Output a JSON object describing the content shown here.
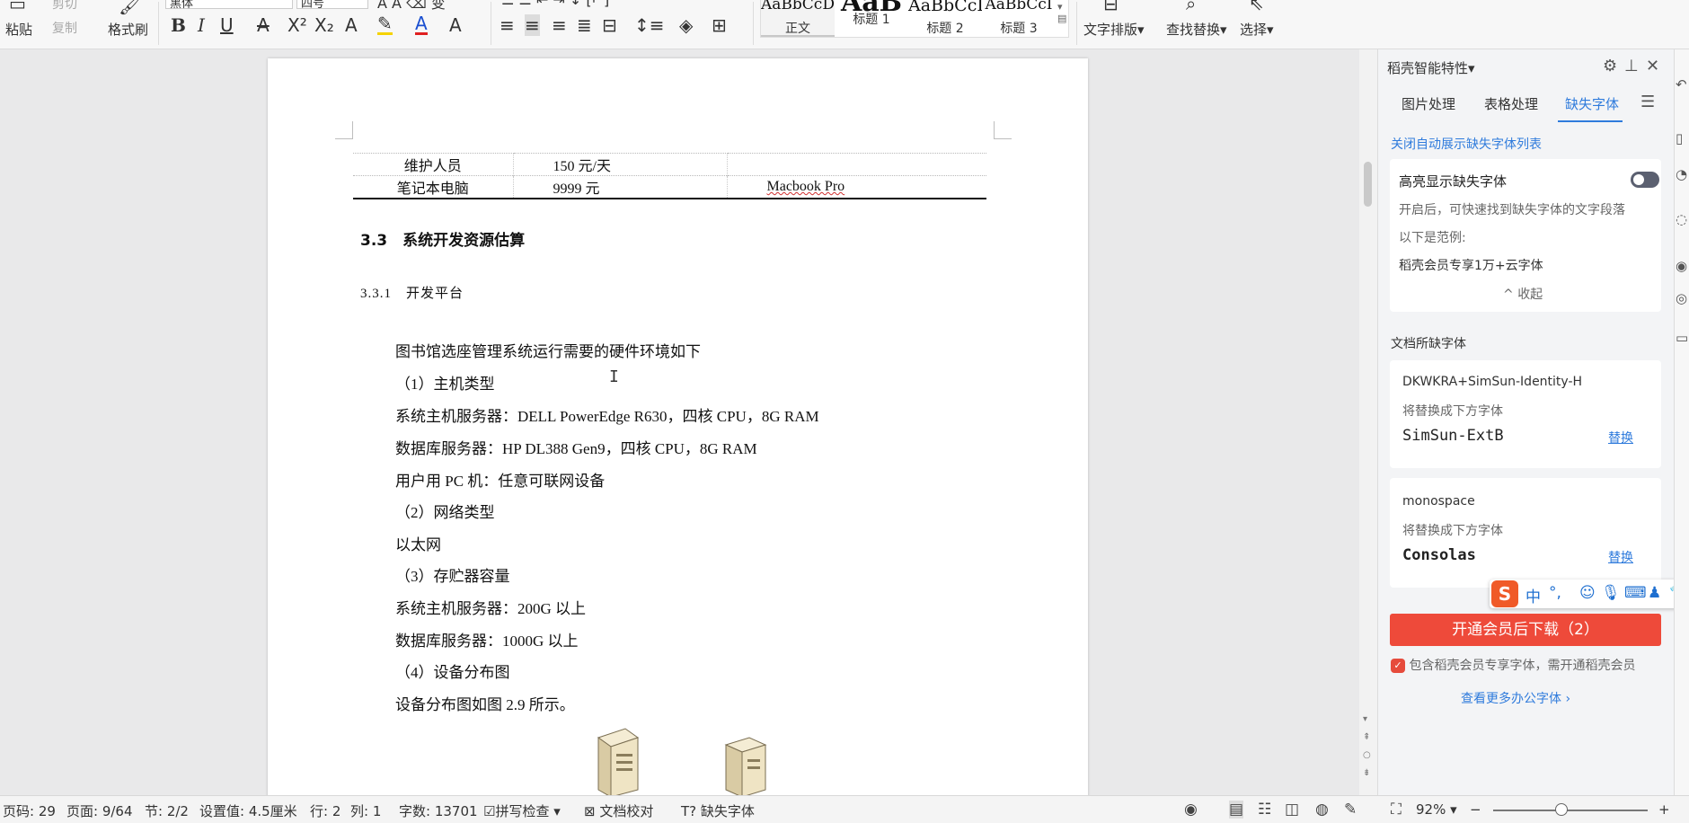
{
  "ribbon": {
    "paste": "粘贴",
    "cut": "剪切",
    "copy": "复制",
    "format_painter": "格式刷",
    "font_name": "黑体",
    "font_size": "四号",
    "styles": [
      {
        "sample": "AaBbCcDc",
        "label": "正文"
      },
      {
        "sample": "AaB",
        "label": "标题 1"
      },
      {
        "sample": "AaBbCcI",
        "label": "标题 2"
      },
      {
        "sample": "AaBbCcI",
        "label": "标题 3"
      }
    ],
    "text_layout": "文字排版",
    "find_replace": "查找替换",
    "select": "选择"
  },
  "document": {
    "table_rows": [
      {
        "item": "维护人员",
        "price": "150 元/天",
        "note": ""
      },
      {
        "item": "笔记本电脑",
        "price": "9999 元",
        "note": "Macbook Pro"
      }
    ],
    "heading_33": "3.3　系统开发资源估算",
    "heading_331": "3.3.1　开发平台",
    "paragraphs": [
      "图书馆选座管理系统运行需要的硬件环境如下",
      "（1）主机类型",
      "系统主机服务器：DELL PowerEdge R630，四核 CPU，8G RAM",
      "数据库服务器：HP DL388 Gen9，四核 CPU，8G RAM",
      "用户用 PC 机：任意可联网设备",
      "（2）网络类型",
      "以太网",
      "（3）存贮器容量",
      "系统主机服务器：200G 以上",
      "数据库服务器：1000G 以上",
      "（4）设备分布图",
      "设备分布图如图 2.9 所示。"
    ]
  },
  "panel": {
    "title": "稻壳智能特性",
    "tabs": [
      "图片处理",
      "表格处理",
      "缺失字体"
    ],
    "close_auto_link": "关闭自动展示缺失字体列表",
    "highlight": {
      "title": "高亮显示缺失字体",
      "desc": "开启后，可快速找到缺失字体的文字段落",
      "example_label": "以下是范例:",
      "example": "稻壳会员专享1万+云字体",
      "collapse": "收起"
    },
    "missing_title": "文档所缺字体",
    "fonts": [
      {
        "name": "DKWKRA+SimSun-Identity-H",
        "hint": "将替换成下方字体",
        "replacement": "SimSun-ExtB",
        "action": "替换"
      },
      {
        "name": "monospace",
        "hint": "将替换成下方字体",
        "replacement": "Consolas",
        "action": "替换"
      }
    ],
    "download_button": "开通会员后下载（2）",
    "member_note": "包含稻壳会员专享字体，需开通稻壳会员",
    "more_link": "查看更多办公字体"
  },
  "ime": {
    "lang": "中",
    "punct": "°,"
  },
  "status": {
    "page_code": "页码: 29",
    "page": "页面: 9/64",
    "section": "节: 2/2",
    "setting": "设置值: 4.5厘米",
    "row": "行: 2",
    "col": "列: 1",
    "words": "字数: 13701",
    "spell": "拼写检查",
    "proof": "文档校对",
    "missing_font": "缺失字体",
    "zoom": "92%"
  },
  "colors": {
    "accent": "#2f7bdc",
    "download": "#ee4a3a"
  }
}
